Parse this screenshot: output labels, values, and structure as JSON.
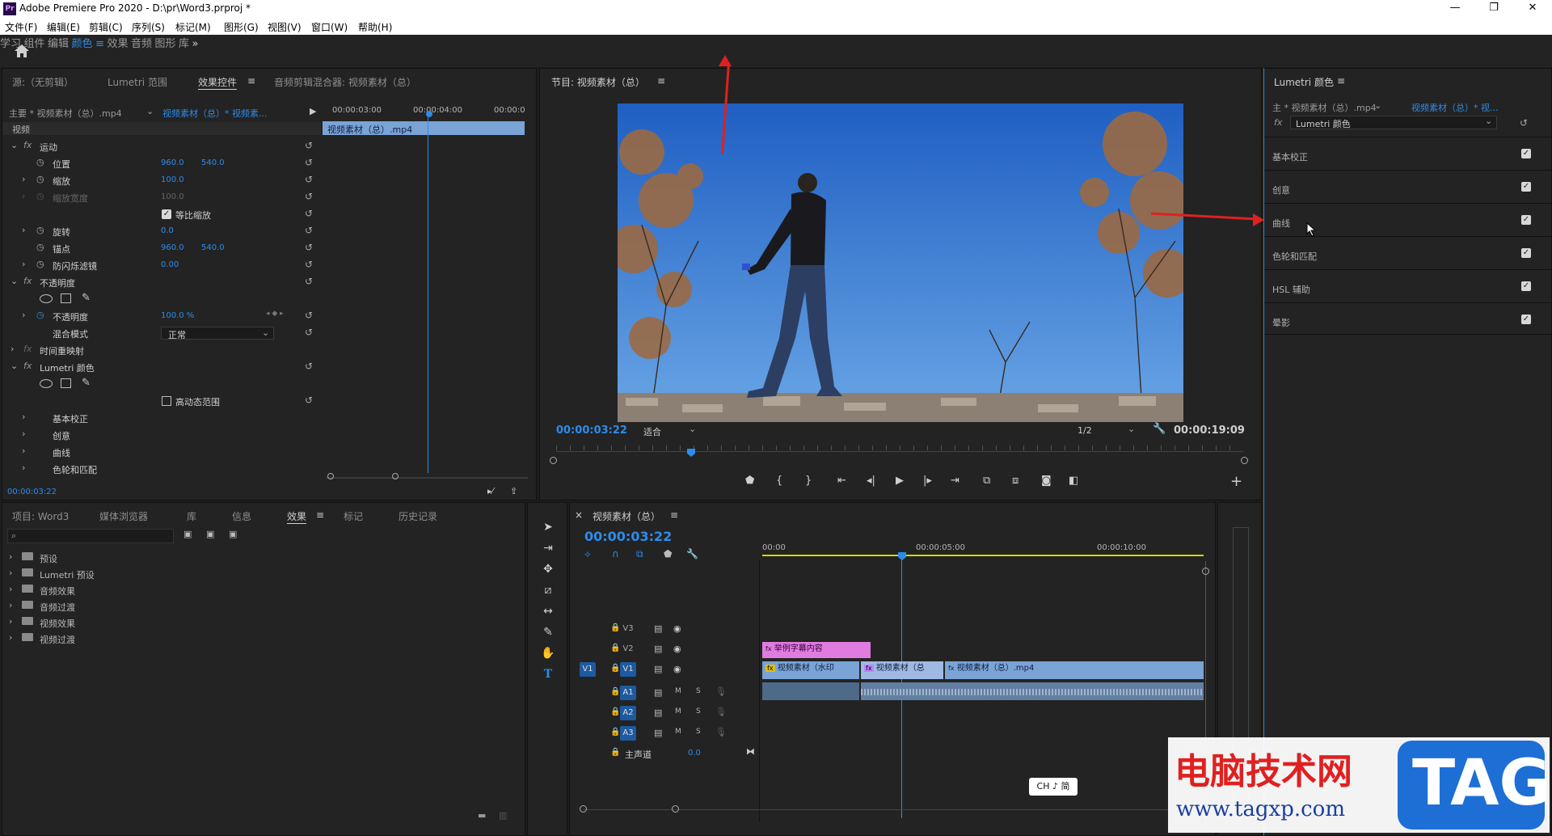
{
  "window": {
    "title": "Adobe Premiere Pro 2020 - D:\\pr\\Word3.prproj *",
    "icon_label": "Pr",
    "controls": [
      "—",
      "❐",
      "✕"
    ]
  },
  "menu": [
    "文件(F)",
    "编辑(E)",
    "剪辑(C)",
    "序列(S)",
    "标记(M)",
    "图形(G)",
    "视图(V)",
    "窗口(W)",
    "帮助(H)"
  ],
  "workspaces": {
    "tabs": [
      "学习",
      "组件",
      "编辑",
      "颜色",
      "效果",
      "音频",
      "图形",
      "库"
    ],
    "active": "颜色",
    "more": "»"
  },
  "source_panel": {
    "tabs": [
      "源:（无剪辑）",
      "Lumetri 范围",
      "效果控件",
      "音频剪辑混合器: 视频素材（总）"
    ],
    "active_tab": "效果控件",
    "clip_master": "主要 * 视频素材（总）.mp4",
    "clip_sequence": "视频素材（总）* 视频素...",
    "timecodes": [
      "00:00:03:00",
      "00:00:04:00",
      "00:00:0"
    ],
    "clip_bar": "视频素材（总）.mp4",
    "section": "视频",
    "motion": {
      "label": "运动",
      "position": {
        "label": "位置",
        "x": "960.0",
        "y": "540.0"
      },
      "scale": {
        "label": "缩放",
        "value": "100.0"
      },
      "scale_width": {
        "label": "缩放宽度",
        "value": "100.0"
      },
      "uniform_scale": "等比缩放",
      "rotation": {
        "label": "旋转",
        "value": "0.0"
      },
      "anchor": {
        "label": "锚点",
        "x": "960.0",
        "y": "540.0"
      },
      "antiflicker": {
        "label": "防闪烁滤镜",
        "value": "0.00"
      }
    },
    "opacity": {
      "label": "不透明度",
      "opacity": {
        "label": "不透明度",
        "value": "100.0 %"
      },
      "blend": {
        "label": "混合模式",
        "value": "正常"
      }
    },
    "time_remap": "时间重映射",
    "lumetri": {
      "label": "Lumetri 颜色",
      "hdr": "高动态范围",
      "items": [
        "基本校正",
        "创意",
        "曲线",
        "色轮和匹配"
      ]
    },
    "current_time": "00:00:03:22"
  },
  "program_monitor": {
    "title": "节目: 视频素材（总）",
    "current_time": "00:00:03:22",
    "fit": "适合",
    "resolution": "1/2",
    "duration": "00:00:19:09"
  },
  "lumetri_panel": {
    "title": "Lumetri 颜色",
    "master": "主 * 视频素材（总）.mp4",
    "sequence": "视频素材（总）* 视...",
    "effect": "Lumetri 颜色",
    "sections": [
      "基本校正",
      "创意",
      "曲线",
      "色轮和匹配",
      "HSL 辅助",
      "晕影"
    ]
  },
  "project_panel": {
    "tabs": [
      "项目: Word3",
      "媒体浏览器",
      "库",
      "信息",
      "效果",
      "标记",
      "历史记录"
    ],
    "active_tab": "效果",
    "search_placeholder": "",
    "folders": [
      "预设",
      "Lumetri 预设",
      "音频效果",
      "音频过渡",
      "视频效果",
      "视频过渡"
    ]
  },
  "timeline": {
    "title": "视频素材（总）",
    "current_time": "00:00:03:22",
    "ruler": [
      "00:00",
      "00:00:05:00",
      "00:00:10:00"
    ],
    "video_tracks": [
      "V3",
      "V2",
      "V1"
    ],
    "audio_tracks": [
      "A1",
      "A2",
      "A3"
    ],
    "source_patch": "V1",
    "master": {
      "label": "主声道",
      "value": "0.0"
    },
    "clips": {
      "title_clip": "举例字幕内容",
      "v1_a": "视频素材（水印",
      "v1_b": "视频素材（总",
      "v1_c": "视频素材（总）.mp4"
    },
    "track_letters": {
      "mute": "M",
      "solo": "S"
    }
  },
  "ime": "CH ♪ 简",
  "watermark": {
    "cn": "电脑技术网",
    "url": "www.tagxp.com",
    "tag": "TAG"
  }
}
